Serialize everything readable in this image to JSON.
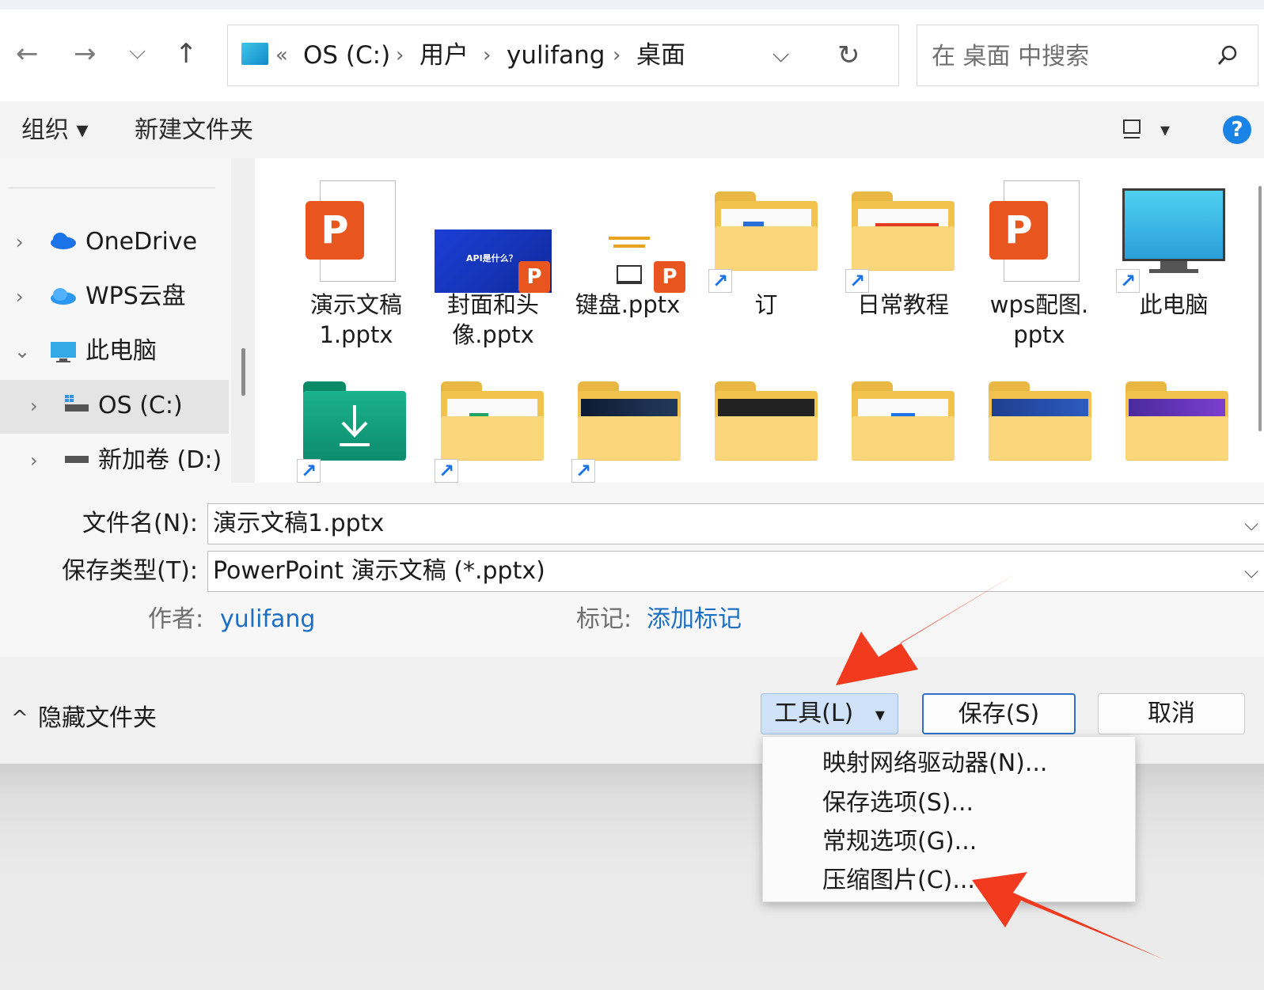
{
  "nav": {
    "back_glyph": "←",
    "forward_glyph": "→",
    "recent_glyph": "⌵",
    "up_glyph": "↑"
  },
  "address": {
    "overflow": "«",
    "crumbs": [
      "OS (C:)",
      "用户",
      "yulifang",
      "桌面"
    ],
    "separator": "›",
    "dropdown_glyph": "⌵",
    "refresh_glyph": "↻"
  },
  "search": {
    "placeholder": "在 桌面 中搜索",
    "icon": "search-icon"
  },
  "toolbar": {
    "organize_label": "组织 ▾",
    "new_folder_label": "新建文件夹",
    "view_dropdown_glyph": "▾",
    "help_glyph": "?"
  },
  "sidebar": {
    "items": [
      {
        "label": "OneDrive",
        "icon": "cloud-icon",
        "chevron": "›"
      },
      {
        "label": "WPS云盘",
        "icon": "cloud-icon",
        "chevron": "›"
      },
      {
        "label": "此电脑",
        "icon": "monitor-icon",
        "chevron": "⌄"
      },
      {
        "label": "OS (C:)",
        "icon": "drive-icon",
        "chevron": "›"
      },
      {
        "label": "新加卷 (D:)",
        "icon": "drive-icon",
        "chevron": "›"
      }
    ]
  },
  "files": {
    "row1": [
      {
        "line1": "演示文稿",
        "line2": "1.pptx",
        "type": "pptx"
      },
      {
        "line1": "封面和头",
        "line2": "像.pptx",
        "type": "pptx-thumb",
        "thumb_text": "API是什么？"
      },
      {
        "line1": "键盘.pptx",
        "line2": "",
        "type": "pptx-thumb"
      },
      {
        "line1": "订",
        "line2": "",
        "type": "folder-shortcut"
      },
      {
        "line1": "日常教程",
        "line2": "",
        "type": "folder-shortcut"
      },
      {
        "line1": "wps配图.",
        "line2": "pptx",
        "type": "pptx"
      },
      {
        "line1": "此电脑",
        "line2": "",
        "type": "pc-shortcut"
      }
    ],
    "shortcut_glyph": "↗",
    "ppt_glyph": "P"
  },
  "form": {
    "filename_label": "文件名(N):",
    "filename_value": "演示文稿1.pptx",
    "filetype_label": "保存类型(T):",
    "filetype_value": "PowerPoint 演示文稿 (*.pptx)",
    "dropdown_glyph": "⌵",
    "author_label": "作者:",
    "author_value": "yulifang",
    "tags_label": "标记:",
    "tags_value": "添加标记"
  },
  "footer": {
    "hide_folders_glyph": "^",
    "hide_folders_label": "隐藏文件夹",
    "tools_label": "工具(L)",
    "tools_caret": "▾",
    "save_label": "保存(S)",
    "cancel_label": "取消"
  },
  "tools_menu": {
    "items": [
      "映射网络驱动器(N)...",
      "保存选项(S)...",
      "常规选项(G)...",
      "压缩图片(C)..."
    ]
  },
  "colors": {
    "accent": "#2f6fc8",
    "link": "#1a6fc4",
    "arrow": "#f23a1f",
    "ppt": "#e8551f",
    "folder": "#f2c24e"
  }
}
